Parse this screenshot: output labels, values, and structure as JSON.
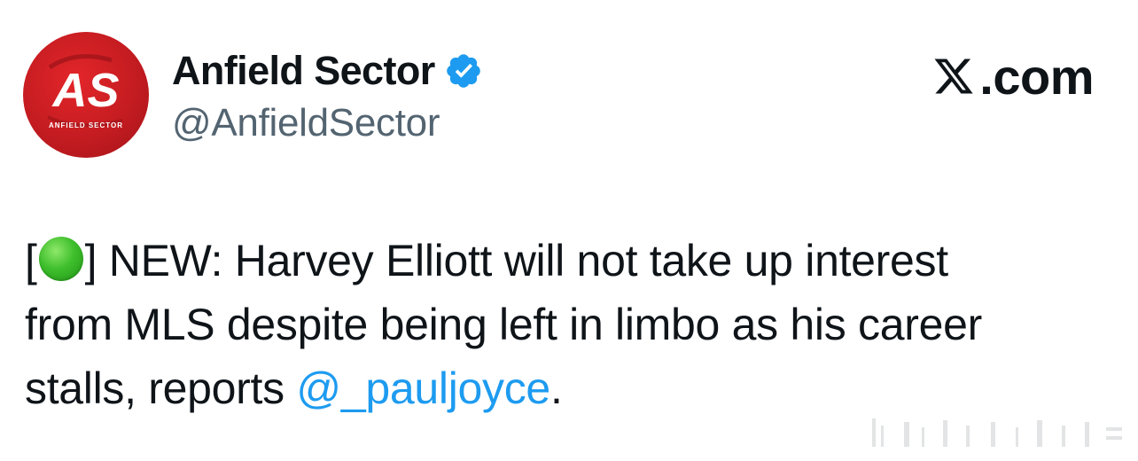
{
  "account": {
    "display_name": "Anfield Sector",
    "handle": "@AnfieldSector",
    "verified": true,
    "avatar_logo_text": "AS",
    "avatar_subtext": "ANFIELD SECTOR"
  },
  "brand": {
    "label": ".com",
    "icon": "x-logo-icon"
  },
  "tweet": {
    "bracket_open": "[",
    "status_emoji": "green-circle-emoji",
    "line1_rest": "] NEW: Harvey Elliott will not take up interest",
    "line2": "from MLS despite being left in limbo as his career",
    "line3_prefix": "stalls, reports ",
    "mention": "@_pauljoyce",
    "line3_suffix": "."
  },
  "colors": {
    "avatar_red": "#c41c21",
    "verified_blue": "#1d9bf0",
    "mention_blue": "#1d9bf0",
    "handle_gray": "#536471",
    "text": "#0f1419"
  }
}
